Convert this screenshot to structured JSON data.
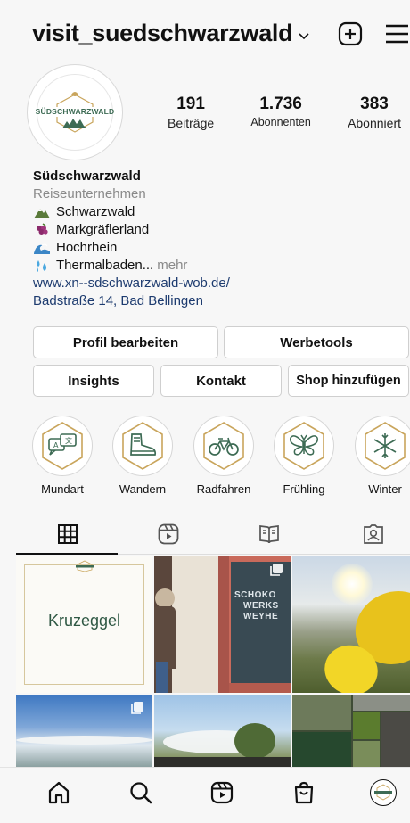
{
  "header": {
    "username": "visit_suedschwarzwald",
    "icons": [
      "chevron-down-icon",
      "plus-square-icon",
      "hamburger-menu-icon"
    ]
  },
  "profile": {
    "logo_text": "SÜDSCHWARZWALD",
    "stats": [
      {
        "value": "191",
        "label": "Beiträge"
      },
      {
        "value": "1.736",
        "label": "Abonnenten"
      },
      {
        "value": "383",
        "label": "Abonniert"
      }
    ],
    "name": "Südschwarzwald",
    "category": "Reiseunternehmen",
    "bio_lines": [
      {
        "emoji": "mountain-icon",
        "text": "Schwarzwald"
      },
      {
        "emoji": "grapes-icon",
        "text": "Markgräflerland"
      },
      {
        "emoji": "wave-icon",
        "text": "Hochrhein"
      },
      {
        "emoji": "droplets-icon",
        "text": "Thermalbaden...",
        "more": "mehr"
      }
    ],
    "website": "www.xn--sdschwarzwald-wob.de/",
    "address": "Badstraße 14, Bad Bellingen"
  },
  "buttons": {
    "edit_profile": "Profil bearbeiten",
    "ad_tools": "Werbetools",
    "insights": "Insights",
    "contact": "Kontakt",
    "add_shop": "Shop hinzufügen"
  },
  "highlights": [
    {
      "label": "Mundart",
      "icon": "speech-translate-icon"
    },
    {
      "label": "Wandern",
      "icon": "hiking-boot-icon"
    },
    {
      "label": "Radfahren",
      "icon": "bicycle-icon"
    },
    {
      "label": "Frühling",
      "icon": "butterfly-icon"
    },
    {
      "label": "Winter",
      "icon": "snowflake-icon"
    }
  ],
  "tabs": [
    "grid-icon",
    "reels-icon",
    "guides-icon",
    "tagged-icon"
  ],
  "posts": {
    "post1_text": "Kruzeggel",
    "post2_sign": [
      "SCHOKO",
      "WERKS",
      "WEYHE"
    ]
  },
  "bottom_nav": [
    "home-icon",
    "search-icon",
    "reels-icon",
    "shop-icon",
    "profile-icon"
  ],
  "colors": {
    "accent_green": "#3d6b54",
    "hexagon_gold": "#c9a55c",
    "link_blue": "#1d3b6f"
  }
}
